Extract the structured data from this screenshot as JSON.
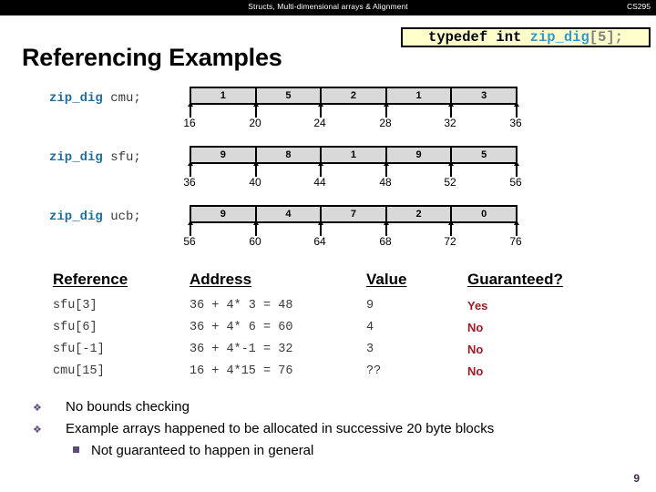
{
  "topbar": {
    "title": "Structs, Multi-dimensional arrays & Alignment",
    "course": "CS295"
  },
  "typedef": {
    "keyword": "typedef int ",
    "type_name": "zip_dig",
    "suffix": "[5];"
  },
  "slide": {
    "title": "Referencing Examples",
    "page_number": "9"
  },
  "arrays": [
    {
      "type_label": "zip_dig",
      "var_label": " cmu;",
      "values": [
        "1",
        "5",
        "2",
        "1",
        "3"
      ],
      "addresses": [
        "16",
        "20",
        "24",
        "28",
        "32",
        "36"
      ]
    },
    {
      "type_label": "zip_dig",
      "var_label": " sfu;",
      "values": [
        "9",
        "8",
        "1",
        "9",
        "5"
      ],
      "addresses": [
        "36",
        "40",
        "44",
        "48",
        "52",
        "56"
      ]
    },
    {
      "type_label": "zip_dig",
      "var_label": " ucb;",
      "values": [
        "9",
        "4",
        "7",
        "2",
        "0"
      ],
      "addresses": [
        "56",
        "60",
        "64",
        "68",
        "72",
        "76"
      ]
    }
  ],
  "table": {
    "headers": {
      "reference": "Reference",
      "address": "Address",
      "value": "Value",
      "guaranteed": "Guaranteed?"
    },
    "rows": [
      {
        "reference": "sfu[3]",
        "address": "36 + 4* 3 = 48",
        "value": "9",
        "guaranteed": "Yes"
      },
      {
        "reference": "sfu[6]",
        "address": "36 + 4* 6 = 60",
        "value": "4",
        "guaranteed": "No"
      },
      {
        "reference": "sfu[-1]",
        "address": "36 + 4*-1 = 32",
        "value": "3",
        "guaranteed": "No"
      },
      {
        "reference": "cmu[15]",
        "address": "16 + 4*15 = 76",
        "value": "??",
        "guaranteed": "No"
      }
    ]
  },
  "bullets": {
    "level1": [
      "No bounds checking",
      "Example arrays happened to be allocated in successive 20 byte blocks"
    ],
    "level1_marker": "❖",
    "level2": [
      "Not guaranteed to happen in general"
    ]
  },
  "colors": {
    "banner": "#000000",
    "code_type": "#3399cc",
    "code_punct": "#808080",
    "label_type": "#1f6f9e",
    "cell_fill": "#d9d9d9",
    "guaranteed_text": "#9b1b24",
    "bullet_marker": "#5f4b7c",
    "typedef_bg": "#ffffcc",
    "page_number": "#3d2b4f"
  }
}
